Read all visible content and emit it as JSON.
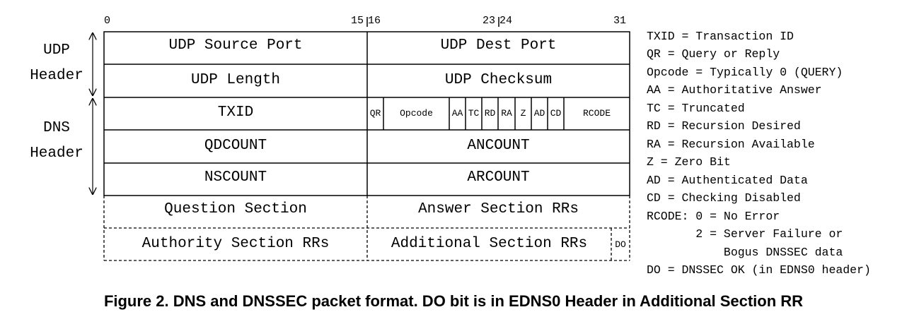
{
  "bit_numbers": {
    "b0": "0",
    "b15": "15",
    "b16": "16",
    "b23": "23",
    "b24": "24",
    "b31": "31"
  },
  "groups": {
    "udp_header": "UDP\nHeader",
    "dns_header": "DNS\nHeader"
  },
  "fields": {
    "udp_source_port": "UDP Source Port",
    "udp_dest_port": "UDP Dest Port",
    "udp_length": "UDP Length",
    "udp_checksum": "UDP Checksum",
    "txid": "TXID",
    "qr": "QR",
    "opcode": "Opcode",
    "aa": "AA",
    "tc": "TC",
    "rd": "RD",
    "ra": "RA",
    "z": "Z",
    "ad": "AD",
    "cd": "CD",
    "rcode": "RCODE",
    "qdcount": "QDCOUNT",
    "ancount": "ANCOUNT",
    "nscount": "NSCOUNT",
    "arcount": "ARCOUNT",
    "question_section": "Question Section",
    "answer_section": "Answer Section RRs",
    "authority_section": "Authority Section RRs",
    "additional_section": "Additional Section RRs",
    "do": "DO"
  },
  "legend": [
    "TXID = Transaction ID",
    "QR = Query or Reply",
    "Opcode = Typically 0 (QUERY)",
    "AA = Authoritative Answer",
    "TC = Truncated",
    "RD = Recursion Desired",
    "RA = Recursion Available",
    "Z = Zero Bit",
    "AD = Authenticated Data",
    "CD = Checking Disabled",
    "RCODE: 0 = No Error",
    "       2 = Server Failure or",
    "           Bogus DNSSEC data",
    "DO = DNSSEC OK (in EDNS0 header)"
  ],
  "caption": "Figure 2. DNS and DNSSEC packet format. DO bit is in EDNS0 Header in Additional Section RR"
}
